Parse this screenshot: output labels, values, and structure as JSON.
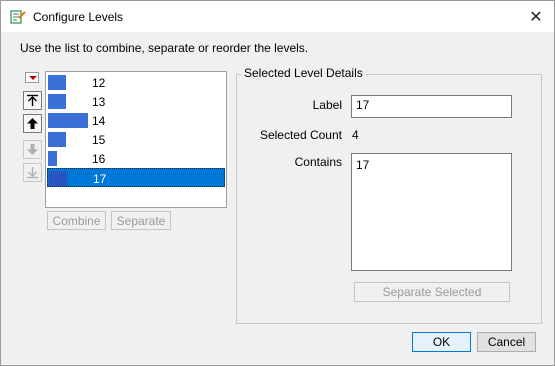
{
  "window": {
    "title": "Configure Levels",
    "close_glyph": "✕"
  },
  "instructions": "Use the list to combine, separate or reorder the levels.",
  "level_list": {
    "items": [
      {
        "label": "12",
        "count_fraction": 0.44,
        "selected": false
      },
      {
        "label": "13",
        "count_fraction": 0.44,
        "selected": false
      },
      {
        "label": "14",
        "count_fraction": 1.0,
        "selected": false
      },
      {
        "label": "15",
        "count_fraction": 0.44,
        "selected": false
      },
      {
        "label": "16",
        "count_fraction": 0.22,
        "selected": false
      },
      {
        "label": "17",
        "count_fraction": 0.44,
        "selected": true
      }
    ],
    "bar_color": "#3a6fd8",
    "selection_color": "#0078d7"
  },
  "side_buttons": {
    "menu_icon": "red-triangle-menu-icon",
    "move_top": {
      "icon": "move-to-top-icon",
      "enabled": true
    },
    "move_up": {
      "icon": "move-up-icon",
      "enabled": true
    },
    "move_down": {
      "icon": "move-down-icon",
      "enabled": false
    },
    "move_bottom": {
      "icon": "move-to-bottom-icon",
      "enabled": false
    }
  },
  "list_actions": {
    "combine_label": "Combine",
    "separate_label": "Separate"
  },
  "details": {
    "group_title": "Selected Level Details",
    "label_caption": "Label",
    "label_value": "17",
    "count_caption": "Selected Count",
    "count_value": "4",
    "contains_caption": "Contains",
    "contains_value": "17",
    "separate_selected_label": "Separate Selected"
  },
  "footer": {
    "ok_label": "OK",
    "cancel_label": "Cancel"
  }
}
